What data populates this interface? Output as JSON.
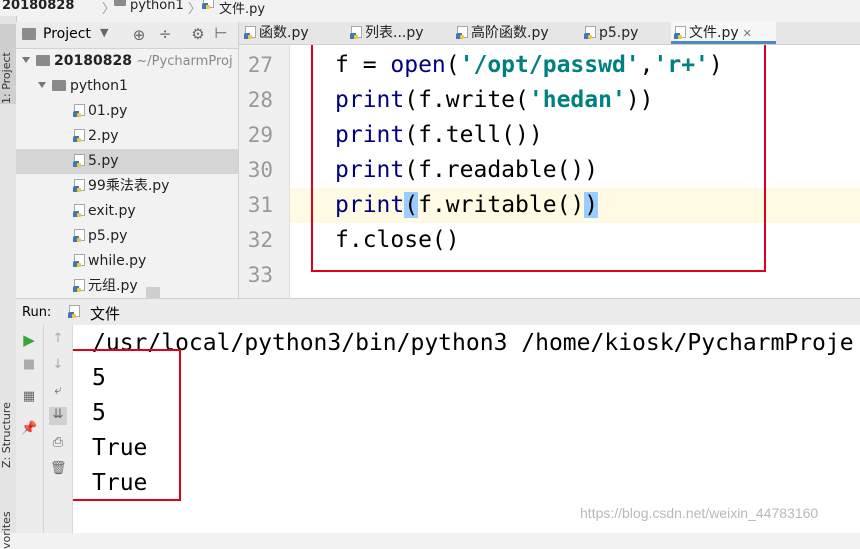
{
  "breadcrumb": {
    "root": "20180828",
    "folder": "python1",
    "file": "文件.py",
    "sep": "〉"
  },
  "left_strip": {
    "project_label": "1: Project",
    "structure_label": "Z: Structure",
    "favorites_label": "vorites"
  },
  "project": {
    "header_label": "Project",
    "root_label": "20180828",
    "root_path": "~/PycharmProj",
    "folder_label": "python1",
    "files": [
      "01.py",
      "2.py",
      "5.py",
      "99乘法表.py",
      "exit.py",
      "p5.py",
      "while.py",
      "元组.py"
    ],
    "selected_file": "5.py"
  },
  "tabs": [
    "函数.py",
    "列表...py",
    "高阶函数.py",
    "p5.py",
    "文件.py"
  ],
  "active_tab": "文件.py",
  "editor": {
    "line_numbers": [
      "27",
      "28",
      "29",
      "30",
      "31",
      "32",
      "33"
    ],
    "lines": {
      "l27_a": "f = ",
      "l27_b": "open",
      "l27_c": "(",
      "l27_d": "'/opt/passwd'",
      "l27_e": ",",
      "l27_f": "'r+'",
      "l27_g": ")",
      "l28_a": "print",
      "l28_b": "(f.write(",
      "l28_c": "'hedan'",
      "l28_d": "))",
      "l29_a": "print",
      "l29_b": "(f.tell())",
      "l30_a": "print",
      "l30_b": "(f.readable())",
      "l31_a": "print",
      "l31_b": "(",
      "l31_c": "f.writable()",
      "l31_d": ")",
      "l32": "f.close()"
    }
  },
  "run": {
    "label": "Run:",
    "config": "文件",
    "command": "/usr/local/python3/bin/python3 /home/kiosk/PycharmProje",
    "output": [
      "5",
      "5",
      "True",
      "True"
    ]
  },
  "watermark": "https://blog.csdn.net/weixin_44783160",
  "colors": {
    "annotation_red": "#e0001b",
    "keyword": "#000080",
    "string": "#008080",
    "brace_highlight": "#99ccff"
  }
}
